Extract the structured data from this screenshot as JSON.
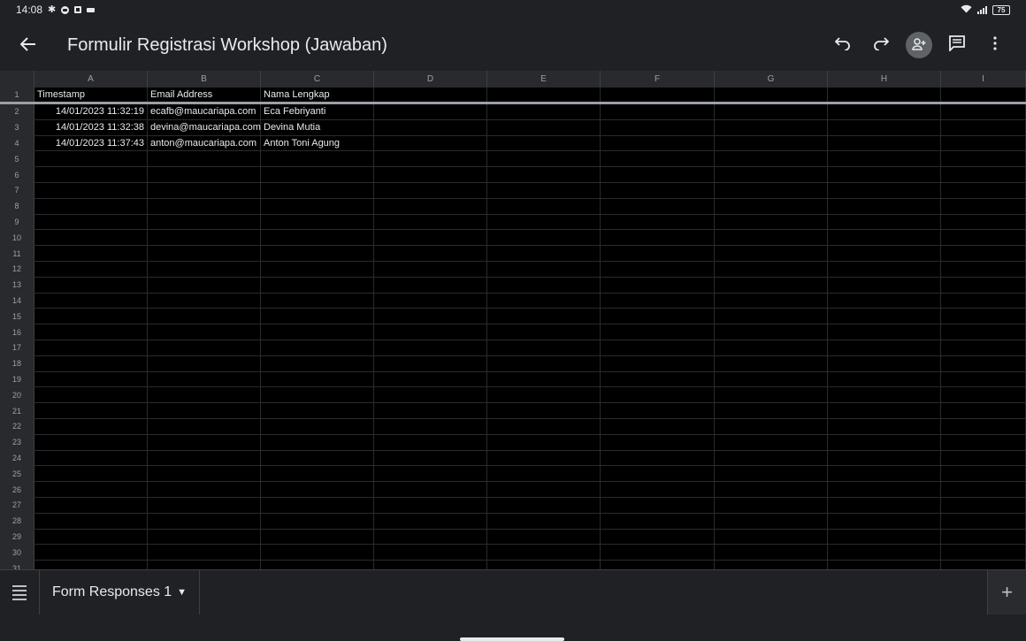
{
  "status_bar": {
    "time": "14:08",
    "battery": "75"
  },
  "app_bar": {
    "title": "Formulir Registrasi Workshop (Jawaban)"
  },
  "grid": {
    "columns": [
      "A",
      "B",
      "C",
      "D",
      "E",
      "F",
      "G",
      "H",
      "I"
    ],
    "rows": [
      {
        "num": "1",
        "cells": [
          "Timestamp",
          "Email Address",
          "Nama Lengkap",
          "",
          "",
          "",
          "",
          "",
          ""
        ]
      },
      {
        "num": "2",
        "cells": [
          "14/01/2023 11:32:19",
          "ecafb@maucariapa.com",
          "Eca Febriyanti",
          "",
          "",
          "",
          "",
          "",
          ""
        ]
      },
      {
        "num": "3",
        "cells": [
          "14/01/2023 11:32:38",
          "devina@maucariapa.com",
          "Devina Mutia",
          "",
          "",
          "",
          "",
          "",
          ""
        ]
      },
      {
        "num": "4",
        "cells": [
          "14/01/2023 11:37:43",
          "anton@maucariapa.com",
          "Anton Toni Agung",
          "",
          "",
          "",
          "",
          "",
          ""
        ]
      },
      {
        "num": "5",
        "cells": [
          "",
          "",
          "",
          "",
          "",
          "",
          "",
          "",
          ""
        ]
      },
      {
        "num": "6",
        "cells": [
          "",
          "",
          "",
          "",
          "",
          "",
          "",
          "",
          ""
        ]
      },
      {
        "num": "7",
        "cells": [
          "",
          "",
          "",
          "",
          "",
          "",
          "",
          "",
          ""
        ]
      },
      {
        "num": "8",
        "cells": [
          "",
          "",
          "",
          "",
          "",
          "",
          "",
          "",
          ""
        ]
      },
      {
        "num": "9",
        "cells": [
          "",
          "",
          "",
          "",
          "",
          "",
          "",
          "",
          ""
        ]
      },
      {
        "num": "10",
        "cells": [
          "",
          "",
          "",
          "",
          "",
          "",
          "",
          "",
          ""
        ]
      },
      {
        "num": "11",
        "cells": [
          "",
          "",
          "",
          "",
          "",
          "",
          "",
          "",
          ""
        ]
      },
      {
        "num": "12",
        "cells": [
          "",
          "",
          "",
          "",
          "",
          "",
          "",
          "",
          ""
        ]
      },
      {
        "num": "13",
        "cells": [
          "",
          "",
          "",
          "",
          "",
          "",
          "",
          "",
          ""
        ]
      },
      {
        "num": "14",
        "cells": [
          "",
          "",
          "",
          "",
          "",
          "",
          "",
          "",
          ""
        ]
      },
      {
        "num": "15",
        "cells": [
          "",
          "",
          "",
          "",
          "",
          "",
          "",
          "",
          ""
        ]
      },
      {
        "num": "16",
        "cells": [
          "",
          "",
          "",
          "",
          "",
          "",
          "",
          "",
          ""
        ]
      },
      {
        "num": "17",
        "cells": [
          "",
          "",
          "",
          "",
          "",
          "",
          "",
          "",
          ""
        ]
      },
      {
        "num": "18",
        "cells": [
          "",
          "",
          "",
          "",
          "",
          "",
          "",
          "",
          ""
        ]
      },
      {
        "num": "19",
        "cells": [
          "",
          "",
          "",
          "",
          "",
          "",
          "",
          "",
          ""
        ]
      },
      {
        "num": "20",
        "cells": [
          "",
          "",
          "",
          "",
          "",
          "",
          "",
          "",
          ""
        ]
      },
      {
        "num": "21",
        "cells": [
          "",
          "",
          "",
          "",
          "",
          "",
          "",
          "",
          ""
        ]
      },
      {
        "num": "22",
        "cells": [
          "",
          "",
          "",
          "",
          "",
          "",
          "",
          "",
          ""
        ]
      },
      {
        "num": "23",
        "cells": [
          "",
          "",
          "",
          "",
          "",
          "",
          "",
          "",
          ""
        ]
      },
      {
        "num": "24",
        "cells": [
          "",
          "",
          "",
          "",
          "",
          "",
          "",
          "",
          ""
        ]
      },
      {
        "num": "25",
        "cells": [
          "",
          "",
          "",
          "",
          "",
          "",
          "",
          "",
          ""
        ]
      },
      {
        "num": "26",
        "cells": [
          "",
          "",
          "",
          "",
          "",
          "",
          "",
          "",
          ""
        ]
      },
      {
        "num": "27",
        "cells": [
          "",
          "",
          "",
          "",
          "",
          "",
          "",
          "",
          ""
        ]
      },
      {
        "num": "28",
        "cells": [
          "",
          "",
          "",
          "",
          "",
          "",
          "",
          "",
          ""
        ]
      },
      {
        "num": "29",
        "cells": [
          "",
          "",
          "",
          "",
          "",
          "",
          "",
          "",
          ""
        ]
      },
      {
        "num": "30",
        "cells": [
          "",
          "",
          "",
          "",
          "",
          "",
          "",
          "",
          ""
        ]
      },
      {
        "num": "31",
        "cells": [
          "",
          "",
          "",
          "",
          "",
          "",
          "",
          "",
          ""
        ]
      }
    ]
  },
  "sheet_tabs": {
    "active_label": "Form Responses 1"
  },
  "icons": {
    "back": "arrow-back-icon",
    "undo": "undo-icon",
    "redo": "redo-icon",
    "share": "add-person-icon",
    "comment": "comment-icon",
    "more": "more-vert-icon",
    "menu": "menu-icon",
    "add": "plus-icon"
  },
  "colors": {
    "background": "#000000",
    "chrome": "#202124",
    "header": "#292a2d",
    "text": "#e8eaed"
  }
}
